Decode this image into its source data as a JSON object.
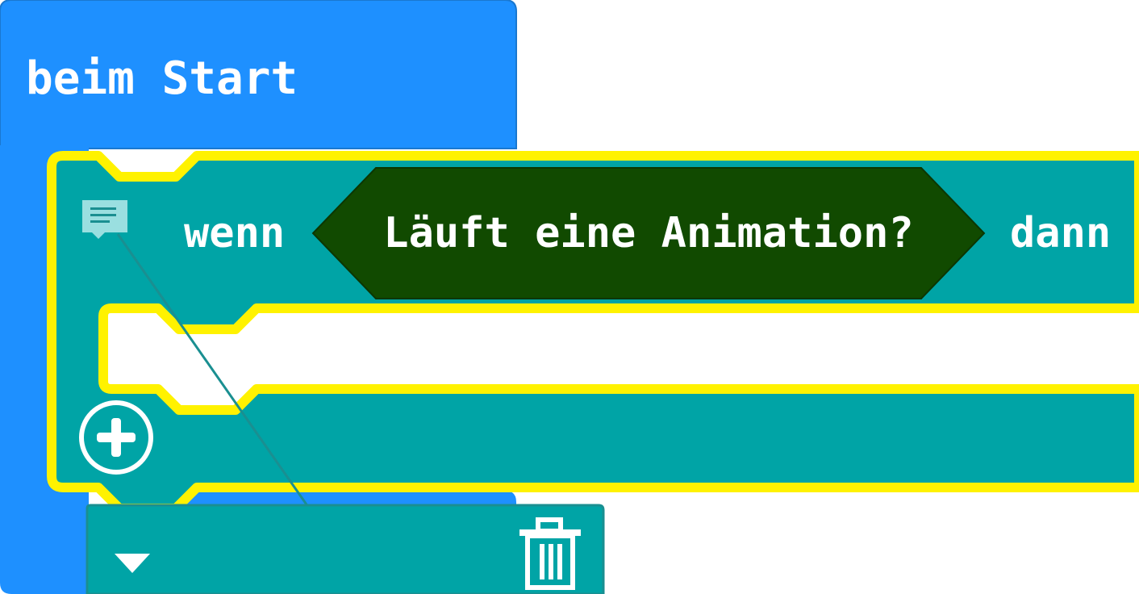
{
  "on_start_block": {
    "label": "beim Start",
    "color": "#1e90ff"
  },
  "if_block": {
    "if_label": "wenn",
    "then_label": "dann",
    "color": "#00a4a6",
    "highlight_color": "#fff200",
    "has_comment": true
  },
  "condition_block": {
    "label": "Läuft eine Animation?",
    "color": "#114a00"
  },
  "comment_bubble": {
    "color": "#00a4a6",
    "collapse_icon": "chevron-down-icon",
    "delete_icon": "trash-icon"
  },
  "icons": {
    "comment": "comment-icon",
    "add": "plus-circle-icon"
  }
}
